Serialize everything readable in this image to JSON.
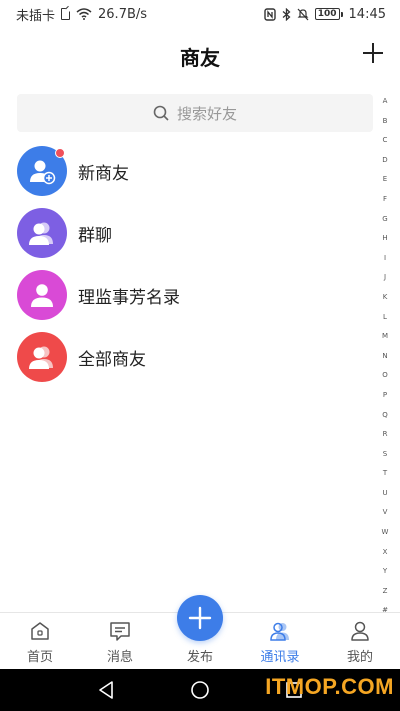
{
  "status_bar": {
    "carrier": "未插卡",
    "speed": "26.7B/s",
    "battery": "100",
    "time": "14:45"
  },
  "header": {
    "title": "商友"
  },
  "search": {
    "placeholder": "搜索好友"
  },
  "contacts": [
    {
      "label": "新商友",
      "color": "#3d7de8",
      "icon": "new-friend-icon",
      "badge": true
    },
    {
      "label": "群聊",
      "color": "#7d5fe3",
      "icon": "group-chat-icon",
      "badge": false
    },
    {
      "label": "理监事芳名录",
      "color": "#d94ad6",
      "icon": "directory-icon",
      "badge": false
    },
    {
      "label": "全部商友",
      "color": "#ef4a4a",
      "icon": "all-friends-icon",
      "badge": false
    }
  ],
  "alpha_index": [
    "A",
    "B",
    "C",
    "D",
    "E",
    "F",
    "G",
    "H",
    "I",
    "J",
    "K",
    "L",
    "M",
    "N",
    "O",
    "P",
    "Q",
    "R",
    "S",
    "T",
    "U",
    "V",
    "W",
    "X",
    "Y",
    "Z",
    "#"
  ],
  "tabs": [
    {
      "label": "首页",
      "icon": "home-icon",
      "active": false
    },
    {
      "label": "消息",
      "icon": "message-icon",
      "active": false
    },
    {
      "label": "发布",
      "icon": "publish-icon",
      "active": false
    },
    {
      "label": "通讯录",
      "icon": "contacts-icon",
      "active": true
    },
    {
      "label": "我的",
      "icon": "profile-icon",
      "active": false
    }
  ],
  "colors": {
    "accent": "#3d7de8"
  },
  "watermark": "ITMOP.COM"
}
